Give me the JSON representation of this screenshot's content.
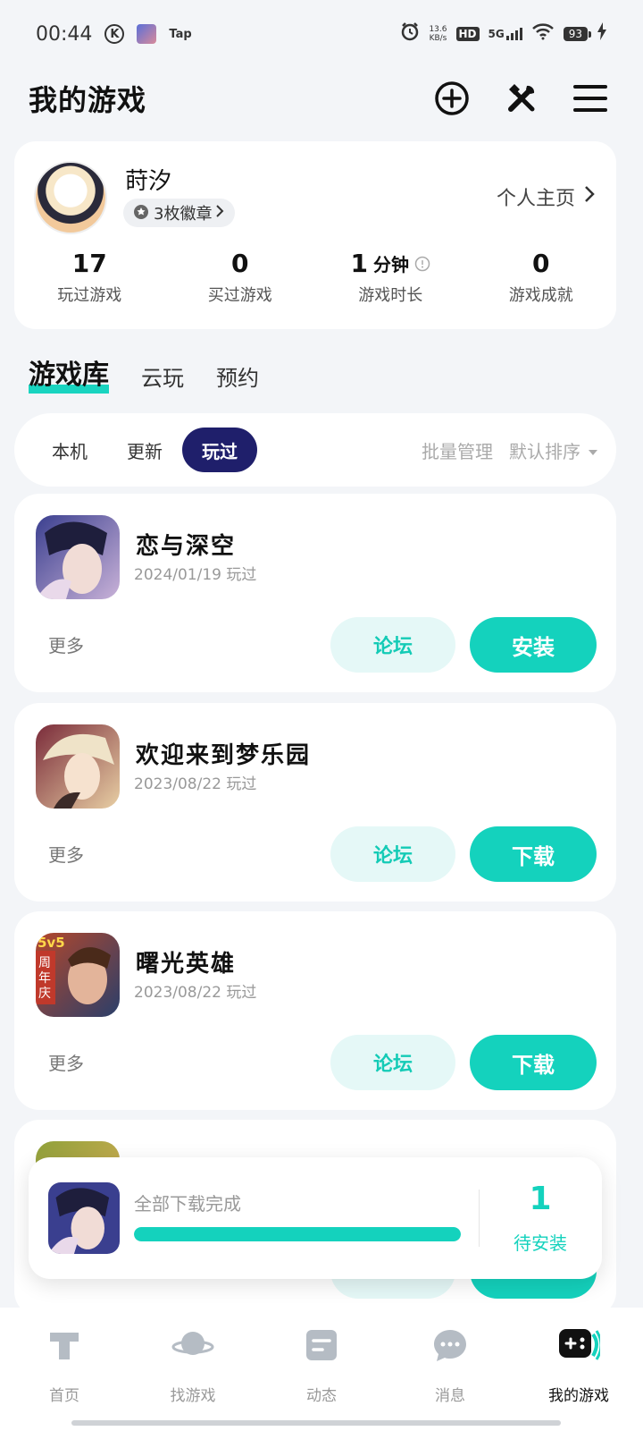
{
  "status_bar": {
    "time": "00:44",
    "k_label": "K",
    "tap_label": "Tap",
    "net_speed": "13.6",
    "net_unit": "KB/s",
    "hd_label": "HD",
    "network": "5G",
    "battery": "93"
  },
  "header": {
    "title": "我的游戏",
    "icons": [
      "add-circle-icon",
      "tools-icon",
      "menu-icon"
    ]
  },
  "profile": {
    "username": "莳汐",
    "badge_text": "3枚徽章",
    "homepage_link": "个人主页",
    "stats": [
      {
        "value": "17",
        "unit": "",
        "label": "玩过游戏"
      },
      {
        "value": "0",
        "unit": "",
        "label": "买过游戏"
      },
      {
        "value": "1",
        "unit": "分钟",
        "label": "游戏时长"
      },
      {
        "value": "0",
        "unit": "",
        "label": "游戏成就"
      }
    ]
  },
  "library_tabs": [
    "游戏库",
    "云玩",
    "预约"
  ],
  "filter": {
    "chips": [
      "本机",
      "更新",
      "玩过"
    ],
    "active_chip": "玩过",
    "batch_manage": "批量管理",
    "sort_label": "默认排序"
  },
  "games": [
    {
      "name": "恋与深空",
      "date": "2024/01/19 玩过",
      "more": "更多",
      "forum": "论坛",
      "action": "安装"
    },
    {
      "name": "欢迎来到梦乐园",
      "date": "2023/08/22 玩过",
      "more": "更多",
      "forum": "论坛",
      "action": "下载"
    },
    {
      "name": "曙光英雄",
      "date": "2023/08/22 玩过",
      "more": "更多",
      "forum": "论坛",
      "action": "下载",
      "icon_tag_top": "5v5",
      "icon_tag_side": "周年庆"
    }
  ],
  "download_toast": {
    "text": "全部下载完成",
    "progress": 1.0,
    "count": "1",
    "count_label": "待安装"
  },
  "bottom_nav": [
    {
      "label": "首页",
      "icon": "tap-home-icon"
    },
    {
      "label": "找游戏",
      "icon": "planet-icon"
    },
    {
      "label": "动态",
      "icon": "feed-icon"
    },
    {
      "label": "消息",
      "icon": "chat-bubble-icon"
    },
    {
      "label": "我的游戏",
      "icon": "gamepad-icon",
      "active": true
    }
  ],
  "colors": {
    "accent": "#14d2bd",
    "active_chip": "#1f1f6b",
    "background": "#f3f5f8"
  }
}
